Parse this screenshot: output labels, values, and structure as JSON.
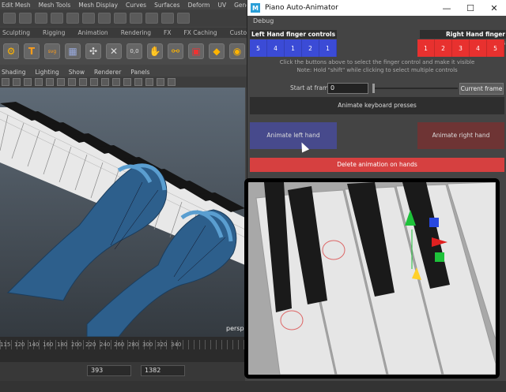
{
  "maya": {
    "menu": [
      "Edit Mesh",
      "Mesh Tools",
      "Mesh Display",
      "Curves",
      "Surfaces",
      "Deform",
      "UV",
      "Gene"
    ],
    "shelf_tabs": [
      "Sculpting",
      "Rigging",
      "Animation",
      "Rendering",
      "FX",
      "FX Caching",
      "Custom"
    ],
    "view_menu": [
      "Shading",
      "Lighting",
      "Show",
      "Renderer",
      "Panels"
    ],
    "viewport_label": "persp",
    "timeline_ticks": [
      "115",
      "120",
      "140",
      "160",
      "180",
      "200",
      "220",
      "240",
      "260",
      "280",
      "300",
      "320",
      "340"
    ],
    "range_start": "393",
    "range_end": "1382"
  },
  "tool": {
    "title": "Piano Auto-Animator",
    "menu_debug": "Debug",
    "left_label": "Left Hand finger controls",
    "right_label": "Right Hand finger controls",
    "left_fingers": [
      "5",
      "4",
      "1",
      "2",
      "1"
    ],
    "right_fingers": [
      "1",
      "2",
      "3",
      "4",
      "5"
    ],
    "note1": "Click the buttons above to select the finger control and make it visible",
    "note2": "Note: Hold \"shift\" while clicking to select multiple controls",
    "start_label": "Start at frame:",
    "start_value": "0",
    "current_frame": "Current frame",
    "animate_keys": "Animate keyboard presses",
    "animate_left": "Animate left hand",
    "animate_right": "Animate right hand",
    "delete_anim": "Delete animation on hands"
  },
  "colors": {
    "left_finger": "#3b4bd6",
    "right_finger": "#e8312f",
    "delete": "#d64040",
    "maya_logo": "#2a9fd8"
  }
}
